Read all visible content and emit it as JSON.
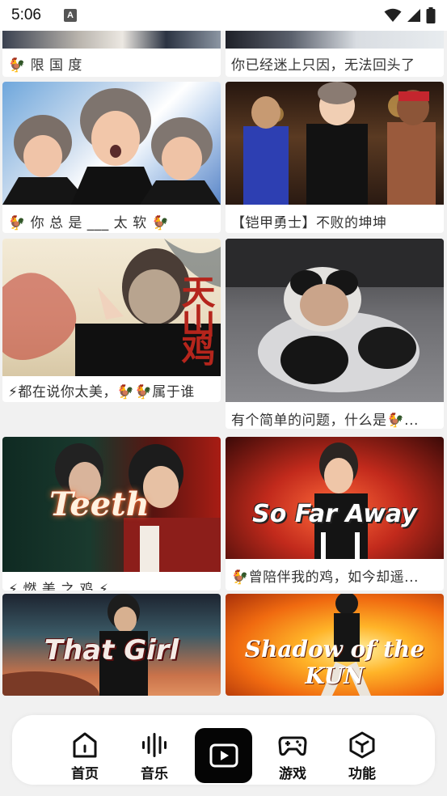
{
  "status_bar": {
    "time": "5:06",
    "notification_badge": "A",
    "icons": [
      "wifi-icon",
      "signal-icon",
      "battery-icon"
    ]
  },
  "feed": {
    "cards": [
      {
        "caption": "🐓 限 国 度"
      },
      {
        "caption": "你已经迷上只因，无法回头了"
      },
      {
        "caption": "🐓 你 总 是 ___ 太 软 🐓"
      },
      {
        "caption": "【铠甲勇士】不败的坤坤"
      },
      {
        "caption": "⚡都在说你太美，🐓🐓属于谁",
        "overlay": "天山鸡"
      },
      {
        "caption": "有个简单的问题，什么是🐓..."
      },
      {
        "caption": "⚡ 燃 美 之 鸡 ⚡",
        "overlay": "Teeth"
      },
      {
        "caption": "🐓曾陪伴我的鸡，如今却遥...",
        "overlay": "So Far Away"
      },
      {
        "caption": "",
        "overlay": "That Girl"
      },
      {
        "caption": "",
        "overlay": "Shadow of the KUN"
      }
    ]
  },
  "bottom_nav": {
    "home": "首页",
    "music": "音乐",
    "video": "",
    "games": "游戏",
    "features": "功能"
  }
}
